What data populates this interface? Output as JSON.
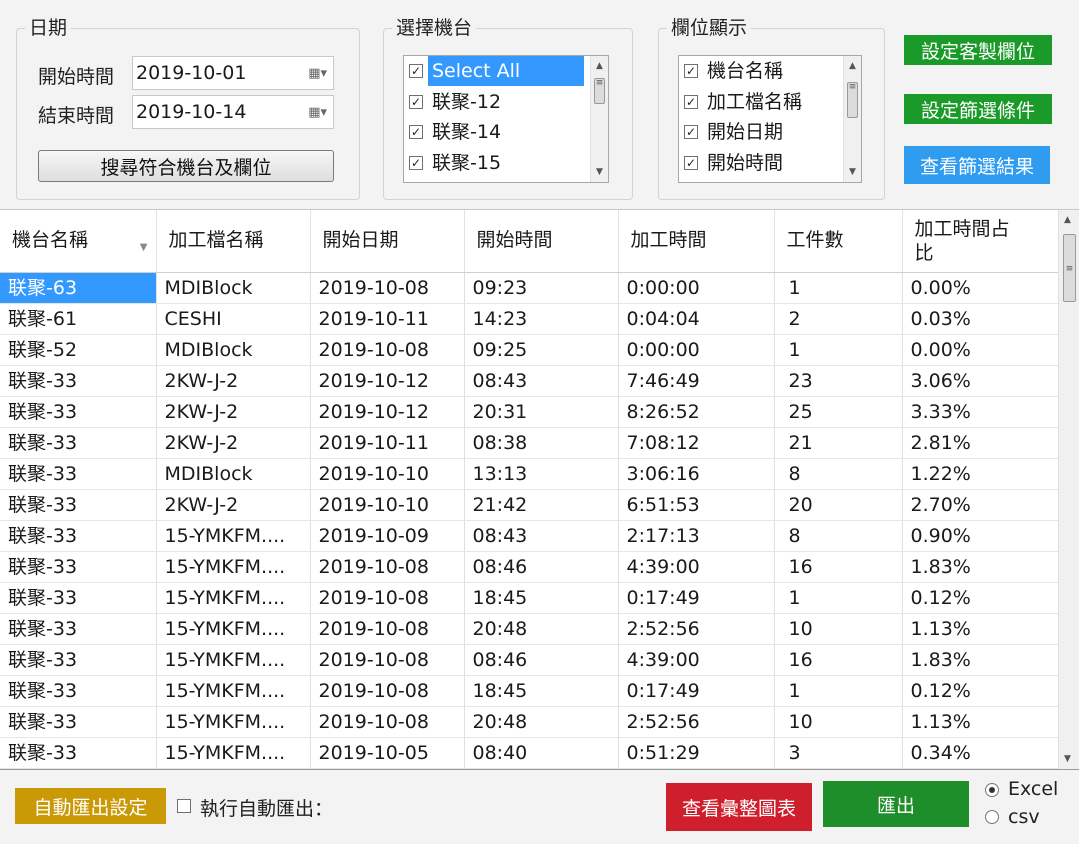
{
  "date_group": {
    "legend": "日期",
    "start_label": "開始時間",
    "start_value": "2019-10-01",
    "end_label": "結束時間",
    "end_value": "2019-10-14",
    "search_button": "搜尋符合機台及欄位"
  },
  "machine_group": {
    "legend": "選擇機台",
    "items": [
      "Select All",
      "联聚-12",
      "联聚-14",
      "联聚-15"
    ]
  },
  "column_group": {
    "legend": "欄位顯示",
    "items": [
      "機台名稱",
      "加工檔名稱",
      "開始日期",
      "開始時間"
    ]
  },
  "side_buttons": {
    "custom_columns": "設定客製欄位",
    "filter_conditions": "設定篩選條件",
    "view_results": "查看篩選結果"
  },
  "table": {
    "headers": [
      "機台名稱",
      "加工檔名稱",
      "開始日期",
      "開始時間",
      "加工時間",
      "工件數",
      "加工時間占\n比"
    ],
    "rows": [
      [
        "联聚-63",
        "MDIBlock",
        "2019-10-08",
        "09:23",
        "0:00:00",
        "1",
        "0.00%"
      ],
      [
        "联聚-61",
        "CESHI",
        "2019-10-11",
        "14:23",
        "0:04:04",
        "2",
        "0.03%"
      ],
      [
        "联聚-52",
        "MDIBlock",
        "2019-10-08",
        "09:25",
        "0:00:00",
        "1",
        "0.00%"
      ],
      [
        "联聚-33",
        "2KW-J-2",
        "2019-10-12",
        "08:43",
        "7:46:49",
        "23",
        "3.06%"
      ],
      [
        "联聚-33",
        "2KW-J-2",
        "2019-10-12",
        "20:31",
        "8:26:52",
        "25",
        "3.33%"
      ],
      [
        "联聚-33",
        "2KW-J-2",
        "2019-10-11",
        "08:38",
        "7:08:12",
        "21",
        "2.81%"
      ],
      [
        "联聚-33",
        "MDIBlock",
        "2019-10-10",
        "13:13",
        "3:06:16",
        "8",
        "1.22%"
      ],
      [
        "联聚-33",
        "2KW-J-2",
        "2019-10-10",
        "21:42",
        "6:51:53",
        "20",
        "2.70%"
      ],
      [
        "联聚-33",
        "15-YMKFM....",
        "2019-10-09",
        "08:43",
        "2:17:13",
        "8",
        "0.90%"
      ],
      [
        "联聚-33",
        "15-YMKFM....",
        "2019-10-08",
        "08:46",
        "4:39:00",
        "16",
        "1.83%"
      ],
      [
        "联聚-33",
        "15-YMKFM....",
        "2019-10-08",
        "18:45",
        "0:17:49",
        "1",
        "0.12%"
      ],
      [
        "联聚-33",
        "15-YMKFM....",
        "2019-10-08",
        "20:48",
        "2:52:56",
        "10",
        "1.13%"
      ],
      [
        "联聚-33",
        "15-YMKFM....",
        "2019-10-08",
        "08:46",
        "4:39:00",
        "16",
        "1.83%"
      ],
      [
        "联聚-33",
        "15-YMKFM....",
        "2019-10-08",
        "18:45",
        "0:17:49",
        "1",
        "0.12%"
      ],
      [
        "联聚-33",
        "15-YMKFM....",
        "2019-10-08",
        "20:48",
        "2:52:56",
        "10",
        "1.13%"
      ],
      [
        "联聚-33",
        "15-YMKFM....",
        "2019-10-05",
        "08:40",
        "0:51:29",
        "3",
        "0.34%"
      ]
    ]
  },
  "bottom": {
    "auto_export_settings": "自動匯出設定",
    "auto_export_checkbox_label": "執行自動匯出：",
    "view_chart": "查看彙整圖表",
    "export": "匯出",
    "format_excel": "Excel",
    "format_csv": "csv"
  },
  "colors": {
    "selection": "#3399ff",
    "green_button": "#1a9a28",
    "blue_button": "#2f9cf0",
    "red_button": "#d01f2c",
    "gold_button": "#c99a06"
  },
  "icons": {
    "calendar": "calendar-dropdown-icon",
    "checkbox_checked": "checkbox-checked-icon",
    "scroll_up": "scroll-up-icon",
    "scroll_down": "scroll-down-icon",
    "sort": "sort-arrow-icon"
  }
}
